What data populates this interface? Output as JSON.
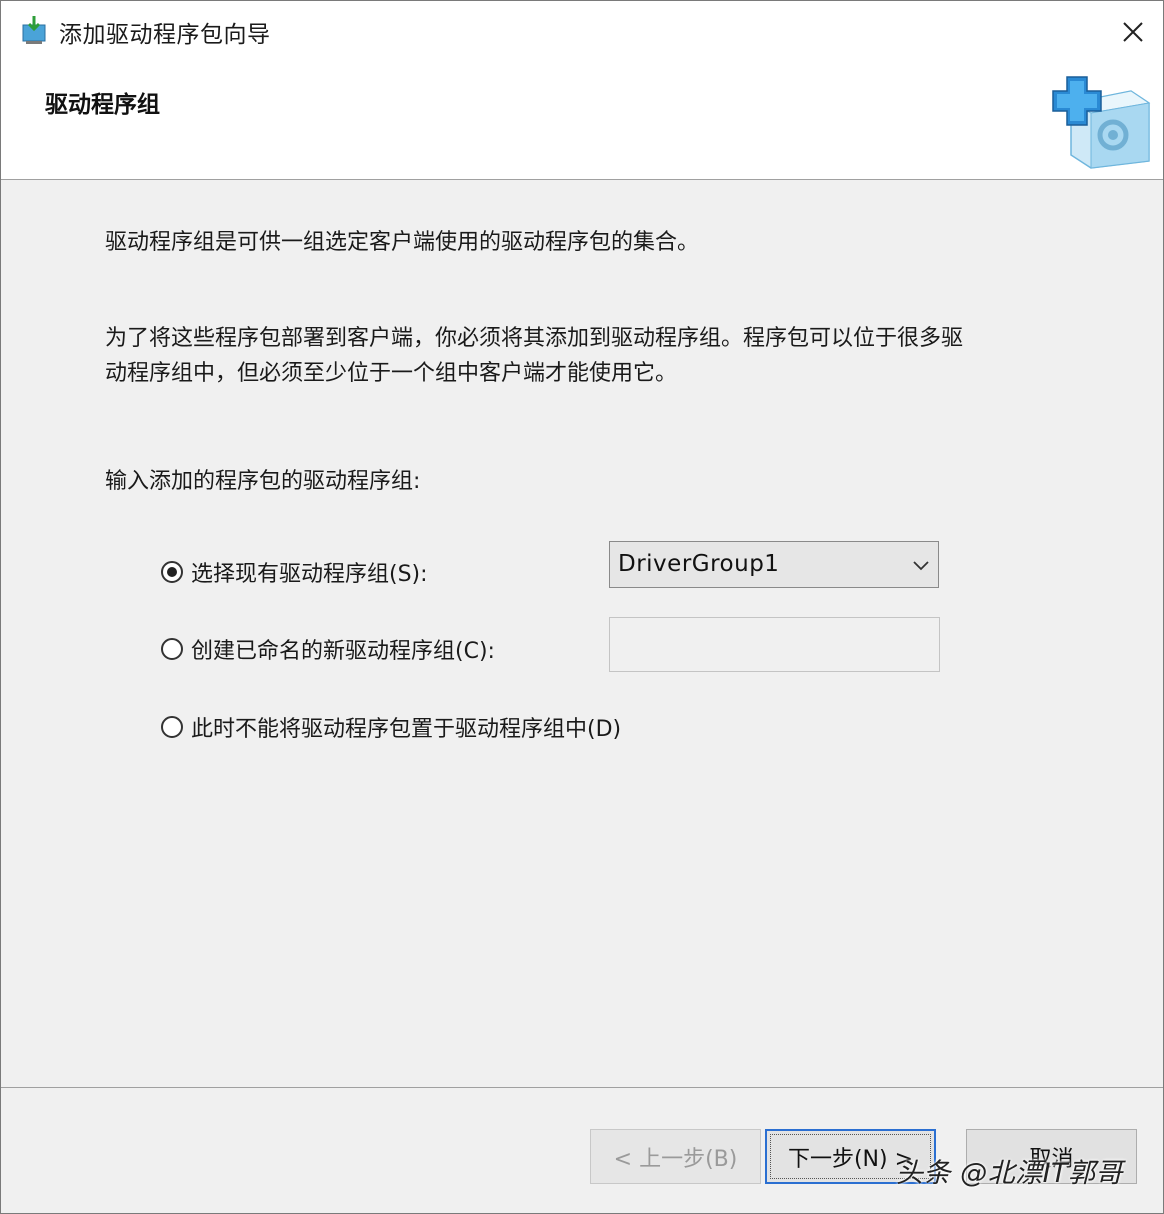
{
  "window": {
    "title": "添加驱动程序包向导",
    "close_glyph": "✕"
  },
  "header": {
    "title": "驱动程序组"
  },
  "content": {
    "description": "驱动程序组是可供一组选定客户端使用的驱动程序包的集合。",
    "info_line1": "为了将这些程序包部署到客户端，你必须将其添加到驱动程序组。程序包可以位于很多驱",
    "info_line2": "动程序组中，但必须至少位于一个组中客户端才能使用它。",
    "prompt": "输入添加的程序包的驱动程序组:",
    "options": [
      {
        "label": "选择现有驱动程序组(S):",
        "checked": true
      },
      {
        "label": "创建已命名的新驱动程序组(C):",
        "checked": false
      },
      {
        "label": "此时不能将驱动程序包置于驱动程序组中(D)",
        "checked": false
      }
    ],
    "existing_group": {
      "selected": "DriverGroup1"
    },
    "new_group_name": {
      "value": ""
    }
  },
  "buttons": {
    "back": "< 上一步(B)",
    "next": "下一步(N) >",
    "cancel": "取消"
  },
  "watermark": "头条 @北漂IT郭哥",
  "icons": {
    "app": "driver-package-icon",
    "header": "add-package-icon",
    "dropdown": "chevron-down-icon"
  },
  "colors": {
    "accent": "#2b6fd1",
    "panel": "#f0f0f0"
  }
}
